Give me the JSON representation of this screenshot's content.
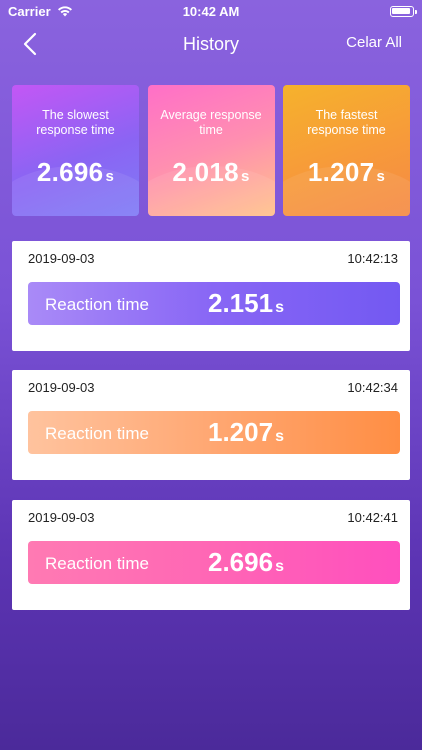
{
  "status_bar": {
    "carrier": "Carrier",
    "time": "10:42 AM"
  },
  "nav": {
    "title": "History",
    "clear_label": "Celar All",
    "back_icon": "chevron-left-icon"
  },
  "stats": [
    {
      "label": "The slowest response time",
      "value": "2.696",
      "unit": "s"
    },
    {
      "label": "Average response time",
      "value": "2.018",
      "unit": "s"
    },
    {
      "label": "The fastest response time",
      "value": "1.207",
      "unit": "s"
    }
  ],
  "records": [
    {
      "date": "2019-09-03",
      "time": "10:42:13",
      "label": "Reaction time",
      "value": "2.151",
      "unit": "s"
    },
    {
      "date": "2019-09-03",
      "time": "10:42:34",
      "label": "Reaction time",
      "value": "1.207",
      "unit": "s"
    },
    {
      "date": "2019-09-03",
      "time": "10:42:41",
      "label": "Reaction time",
      "value": "2.696",
      "unit": "s"
    }
  ]
}
